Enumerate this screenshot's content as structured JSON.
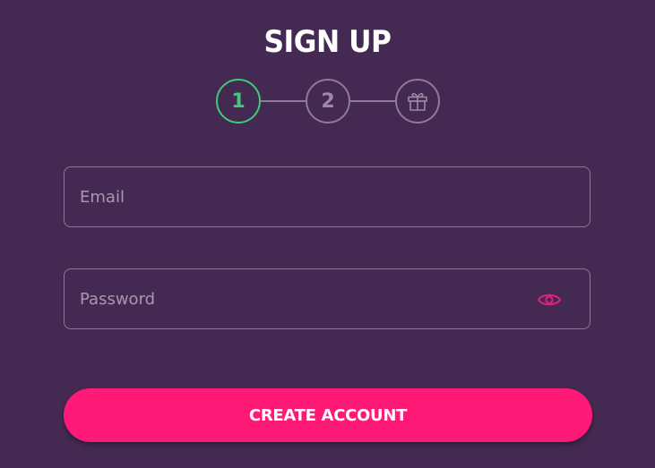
{
  "header": {
    "title": "SIGN UP"
  },
  "steps": [
    {
      "label": "1",
      "state": "active"
    },
    {
      "label": "2",
      "state": "inactive"
    },
    {
      "label": "",
      "icon": "gift-icon",
      "state": "inactive"
    }
  ],
  "form": {
    "email": {
      "placeholder": "Email",
      "value": ""
    },
    "password": {
      "placeholder": "Password",
      "value": "",
      "toggle_icon": "eye-icon"
    },
    "submit_label": "CREATE ACCOUNT"
  },
  "colors": {
    "background": "#442a52",
    "accent": "#ff1a78",
    "step_active": "#3fca78",
    "step_inactive": "#8e7b97"
  }
}
